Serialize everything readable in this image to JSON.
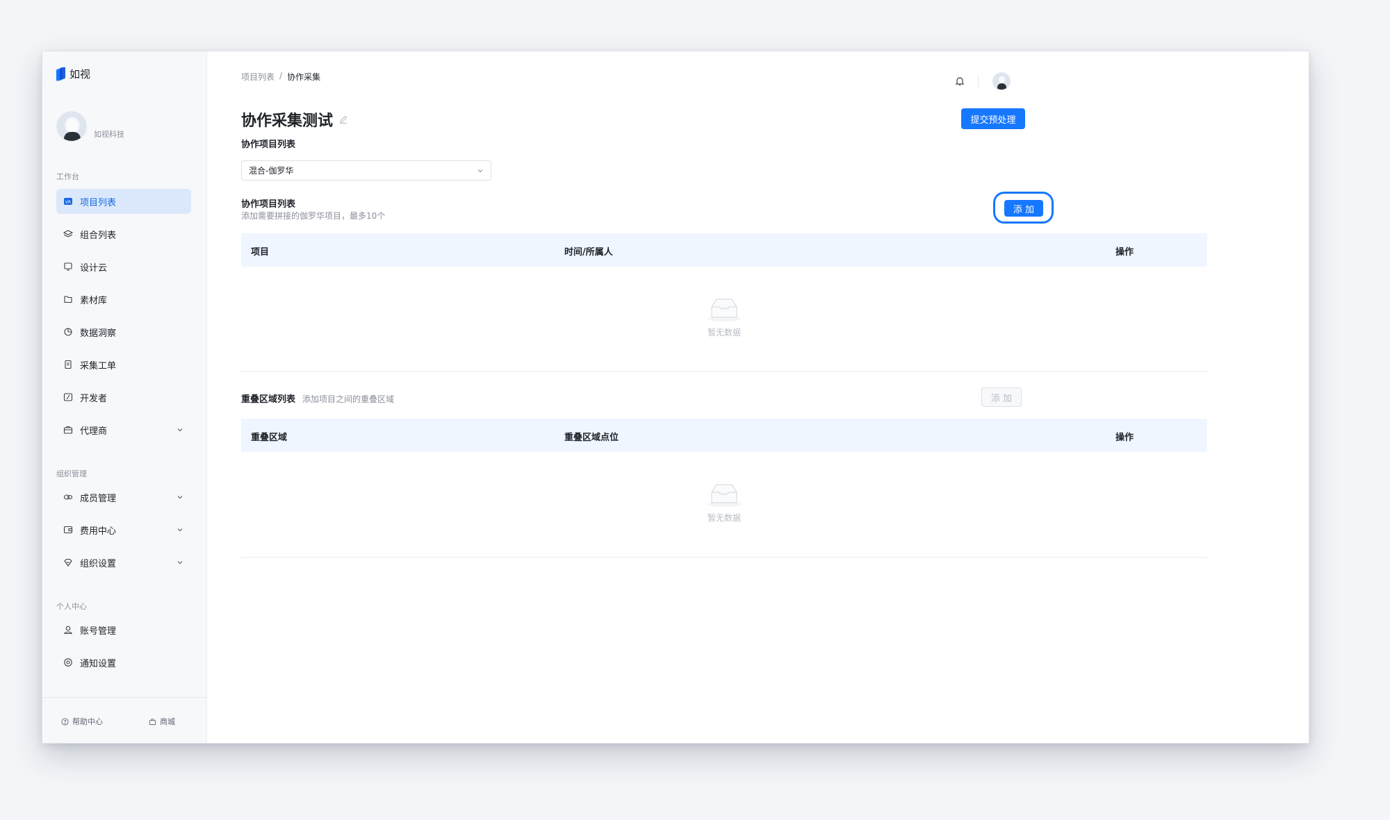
{
  "app": {
    "name": "如视"
  },
  "profile": {
    "org_name": "如视科技"
  },
  "sidebar": {
    "sections": [
      {
        "label": "工作台"
      },
      {
        "label": "组织管理"
      },
      {
        "label": "个人中心"
      }
    ],
    "items": [
      {
        "label": "项目列表",
        "icon": "vr-icon",
        "active": true
      },
      {
        "label": "组合列表",
        "icon": "layers-icon"
      },
      {
        "label": "设计云",
        "icon": "monitor-icon"
      },
      {
        "label": "素材库",
        "icon": "folder-icon"
      },
      {
        "label": "数据洞察",
        "icon": "pie-chart-icon"
      },
      {
        "label": "采集工单",
        "icon": "document-icon"
      },
      {
        "label": "开发者",
        "icon": "code-icon"
      },
      {
        "label": "代理商",
        "icon": "briefcase-icon",
        "expandable": true
      },
      {
        "label": "成员管理",
        "icon": "members-icon",
        "expandable": true
      },
      {
        "label": "费用中心",
        "icon": "wallet-icon",
        "expandable": true
      },
      {
        "label": "组织设置",
        "icon": "diamond-icon",
        "expandable": true
      },
      {
        "label": "账号管理",
        "icon": "user-icon"
      },
      {
        "label": "通知设置",
        "icon": "settings-icon"
      }
    ],
    "footer": {
      "help": "帮助中心",
      "shop": "商城"
    }
  },
  "breadcrumb": {
    "parent": "项目列表",
    "separator": "/",
    "current": "协作采集"
  },
  "page": {
    "title": "协作采集测试",
    "submit_button": "提交预处理",
    "collab_list_label": "协作项目列表",
    "select_value": "混合-伽罗华",
    "collab_section_title": "协作项目列表",
    "collab_section_hint": "添加需要拼接的伽罗华项目，最多10个",
    "add_button": "添 加",
    "table1": {
      "headers": [
        "项目",
        "时间/所属人",
        "操作"
      ],
      "empty_text": "暂无数据"
    },
    "overlap_title": "重叠区域列表",
    "overlap_hint": "添加项目之间的重叠区域",
    "overlap_add_button": "添 加",
    "table2": {
      "headers": [
        "重叠区域",
        "重叠区域点位",
        "操作"
      ],
      "empty_text": "暂无数据"
    }
  },
  "colors": {
    "primary": "#1677ff",
    "active_bg": "#dbe8fb",
    "table_header_bg": "#f0f6ff"
  }
}
